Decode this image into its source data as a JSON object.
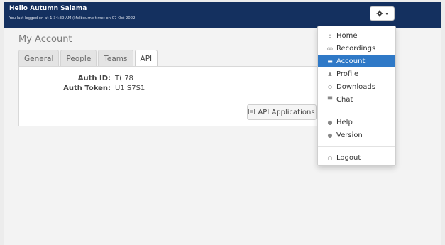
{
  "header": {
    "greeting": "Hello Autumn Salama",
    "last_login": "You last logged on at 1:34:39 AM (Melbourne time) on 07 Oct 2022",
    "settings_icon": "gear-icon"
  },
  "page": {
    "title": "My Account",
    "tabs": [
      {
        "label": "General",
        "active": false
      },
      {
        "label": "People",
        "active": false
      },
      {
        "label": "Teams",
        "active": false
      },
      {
        "label": "API",
        "active": true
      }
    ],
    "auth_id_label": "Auth ID:",
    "auth_id_value": "T(        78",
    "auth_token_label": "Auth Token:",
    "auth_token_value": "U1              S7S1",
    "api_button_label": "API Applications"
  },
  "menu": {
    "items": [
      {
        "label": "Home",
        "icon": "home-icon"
      },
      {
        "label": "Recordings",
        "icon": "voicemail-icon"
      },
      {
        "label": "Account",
        "icon": "briefcase-icon",
        "active": true
      },
      {
        "label": "Profile",
        "icon": "user-icon"
      },
      {
        "label": "Downloads",
        "icon": "download-icon"
      },
      {
        "label": "Chat",
        "icon": "chat-icon"
      },
      {
        "label": "Help",
        "icon": "help-icon"
      },
      {
        "label": "Version",
        "icon": "info-icon"
      },
      {
        "label": "Logout",
        "icon": "power-icon"
      }
    ]
  },
  "colors": {
    "header_bg": "#14305f",
    "active_menu_bg": "#2f79c7"
  }
}
